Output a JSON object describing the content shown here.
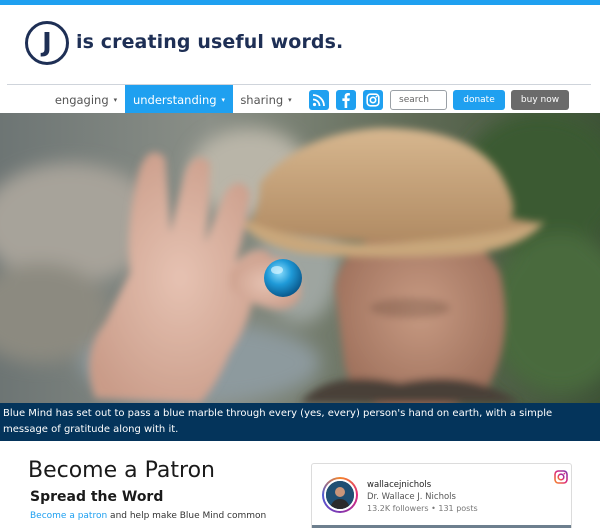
{
  "header": {
    "logo_letter": "J",
    "tagline": "is creating useful words.",
    "accent_color": "#1fa0f0",
    "brand_color": "#1e2f55"
  },
  "nav": {
    "items": [
      {
        "label": "engaging",
        "active": false
      },
      {
        "label": "understanding",
        "active": true
      },
      {
        "label": "sharing",
        "active": false
      }
    ],
    "caret": "▾",
    "social": [
      "rss-icon",
      "facebook-icon",
      "instagram-icon"
    ],
    "search_placeholder": "search",
    "donate_label": "donate",
    "buy_now_label": "buy now"
  },
  "hero": {
    "caption": "Blue Mind has set out to pass a blue marble through every (yes, every) person's hand on earth, with a simple message of gratitude along with it.",
    "caption_bg": "#04345b"
  },
  "patron": {
    "title": "Become a Patron",
    "subtitle": "Spread the Word",
    "link_text": "Become a patron",
    "text_rest": " and help make Blue Mind common"
  },
  "instagram": {
    "handle": "wallacejnichols",
    "name": "Dr. Wallace J. Nichols",
    "stats": "13.2K followers • 131 posts"
  }
}
